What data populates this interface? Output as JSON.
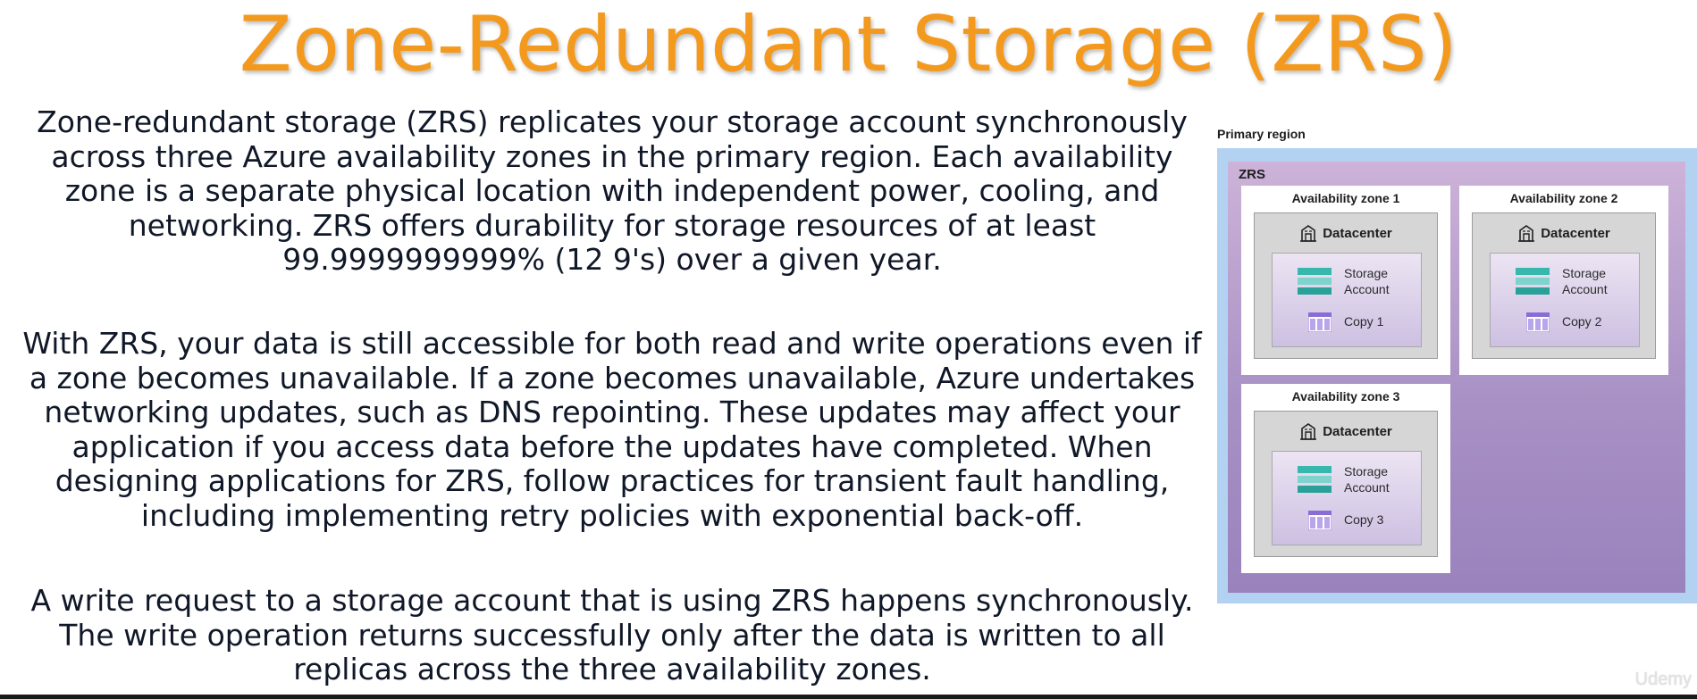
{
  "title": "Zone-Redundant Storage (ZRS)",
  "paragraphs": [
    "Zone-redundant storage (ZRS) replicates your storage account synchronously across three Azure availability zones in the primary region. Each availability zone is a separate physical location with independent power, cooling, and networking. ZRS offers durability for storage resources of at least 99.9999999999% (12 9's) over a given year.",
    "With ZRS, your data is still accessible for both read and write operations even if a zone becomes unavailable. If a zone becomes unavailable, Azure undertakes networking updates, such as DNS repointing. These updates may affect your application if you access data before the updates have completed. When designing applications for ZRS, follow practices for transient fault handling, including implementing retry policies with exponential back-off.",
    "A write request to a storage account that is using ZRS happens synchronously. The write operation returns successfully only after the data is written to all replicas across the three availability zones."
  ],
  "diagram": {
    "region_label": "Primary region",
    "zrs_label": "ZRS",
    "zones": [
      {
        "title": "Availability zone 1",
        "datacenter": "Datacenter",
        "storage_line1": "Storage",
        "storage_line2": "Account",
        "copy": "Copy 1"
      },
      {
        "title": "Availability zone 2",
        "datacenter": "Datacenter",
        "storage_line1": "Storage",
        "storage_line2": "Account",
        "copy": "Copy 2"
      },
      {
        "title": "Availability zone 3",
        "datacenter": "Datacenter",
        "storage_line1": "Storage",
        "storage_line2": "Account",
        "copy": "Copy 3"
      }
    ]
  },
  "watermark": "Udemy",
  "colors": {
    "title": "#f39a1e",
    "region": "#b3d2f2",
    "zrs_top": "#cdb3d9",
    "zrs_bottom": "#9a82bd",
    "storage_teal": "#33b3aa",
    "copy_purple": "#8a6cd6"
  }
}
